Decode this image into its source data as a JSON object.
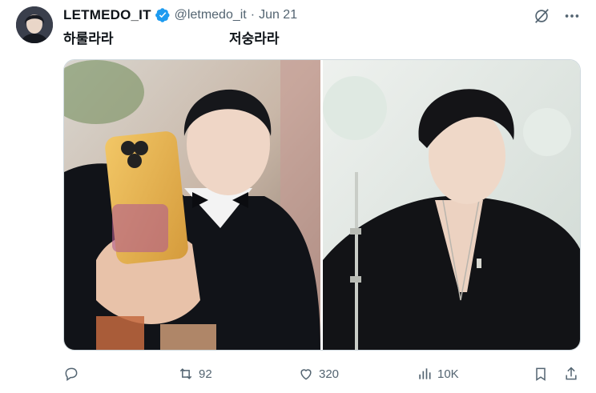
{
  "tweet": {
    "author": {
      "display_name": "LETMEDO_IT",
      "handle": "@letmedo_it",
      "verified": true
    },
    "date": "Jun 21",
    "separator": "·",
    "text_left": "하룰라라",
    "text_right": "저숭라라",
    "stats": {
      "replies": "",
      "retweets": "92",
      "likes": "320",
      "views": "10K"
    }
  },
  "icons": {
    "top": [
      "grok-icon",
      "more-icon"
    ],
    "actions": [
      "reply-icon",
      "retweet-icon",
      "like-icon",
      "views-icon",
      "bookmark-icon",
      "share-icon"
    ]
  },
  "colors": {
    "verified": "#1d9bf0",
    "secondary_text": "#536471",
    "primary_text": "#0f1419"
  }
}
